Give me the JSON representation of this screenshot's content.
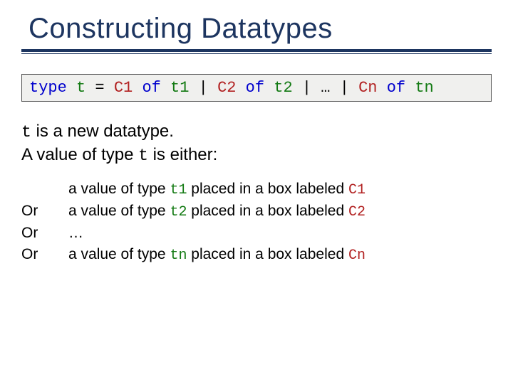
{
  "title": "Constructing Datatypes",
  "code": {
    "kw_type": "type",
    "t": "t",
    "eq": " = ",
    "c1": "C1",
    "of": "of",
    "t1": "t1",
    "bar": " | ",
    "c2": "C2",
    "t2": "t2",
    "dots": "…",
    "cn": "Cn",
    "tn": "tn"
  },
  "para": {
    "t": "t",
    "line1_rest": "  is a new datatype.",
    "line2_pre": "A value of type ",
    "line2_t": "t",
    "line2_post": " is either:"
  },
  "bullets": {
    "or": "Or",
    "dots": "…",
    "b1": {
      "pre": "a value of type ",
      "ty": "t1",
      "mid": " placed in a box labeled ",
      "con": "C1"
    },
    "b2": {
      "pre": "a value of type ",
      "ty": "t2",
      "mid": " placed in a box labeled ",
      "con": "C2"
    },
    "bn": {
      "pre": "a value of type ",
      "ty": "tn",
      "mid": " placed in a box labeled ",
      "con": "Cn"
    }
  }
}
